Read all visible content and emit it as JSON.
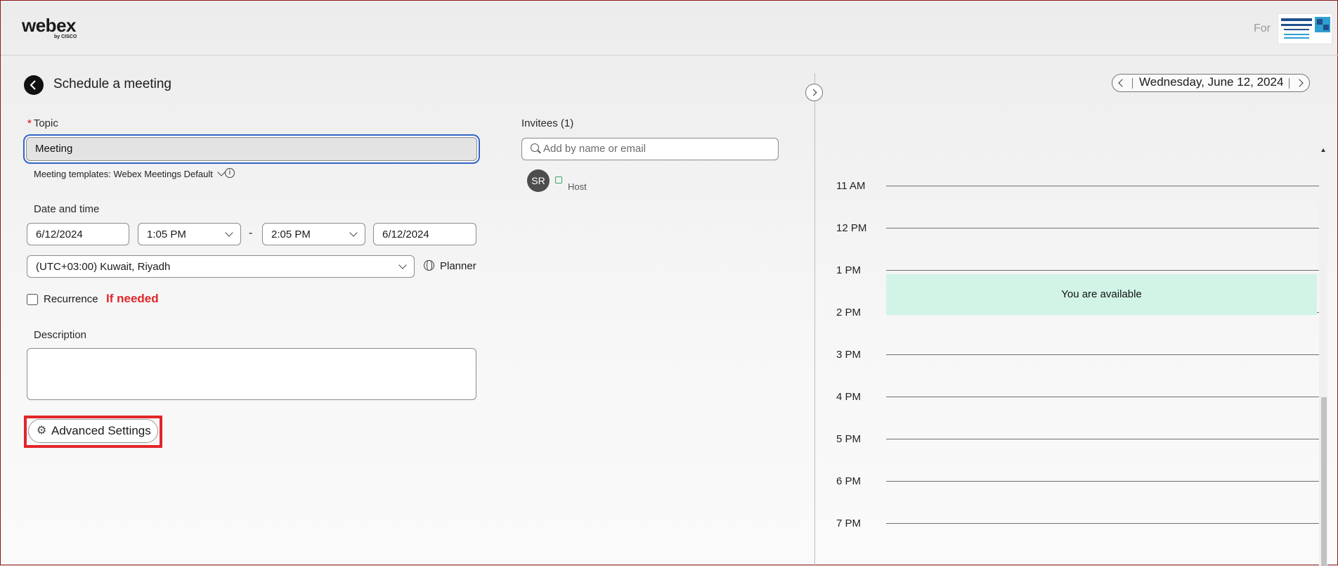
{
  "header": {
    "brand": "webex",
    "brand_sub": "by CISCO",
    "for_label": "For"
  },
  "page": {
    "title": "Schedule a meeting"
  },
  "topic": {
    "label": "Topic",
    "required_mark": "*",
    "value": "Meeting"
  },
  "template": {
    "text": "Meeting templates: Webex Meetings Default",
    "info_glyph": "i"
  },
  "datetime": {
    "label": "Date and time",
    "start_date": "6/12/2024",
    "start_time": "1:05 PM",
    "separator": "-",
    "end_time": "2:05 PM",
    "end_date": "6/12/2024",
    "timezone": "(UTC+03:00) Kuwait, Riyadh",
    "planner_label": "Planner"
  },
  "recurrence": {
    "label": "Recurrence",
    "checked": false,
    "annotation": "If needed"
  },
  "description": {
    "label": "Description",
    "value": ""
  },
  "advanced": {
    "label": "Advanced Settings",
    "gear_glyph": "⚙"
  },
  "invitees": {
    "label": "Invitees (1)",
    "placeholder": "Add by name or email",
    "list": [
      {
        "initials": "SR",
        "role": "Host"
      }
    ]
  },
  "calendar": {
    "date": "Wednesday, June 12, 2024",
    "hours": [
      "11 AM",
      "12 PM",
      "1 PM",
      "2 PM",
      "3 PM",
      "4 PM",
      "5 PM",
      "6 PM",
      "7 PM"
    ],
    "availability": "You are available"
  },
  "colors": {
    "accent": "#2f63c4",
    "annotation": "#e0262a",
    "available": "#d1f4e7"
  }
}
